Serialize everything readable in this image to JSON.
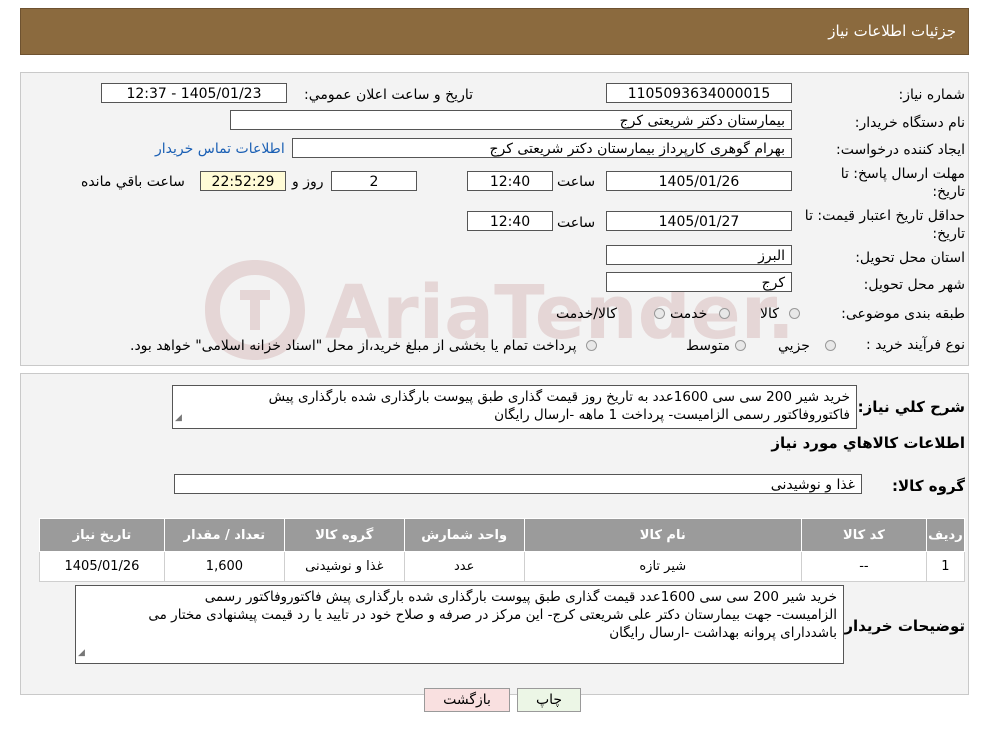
{
  "header": {
    "title": "جزئیات اطلاعات نیاز"
  },
  "fields": {
    "need_number_label": "شماره نیاز:",
    "need_number": "1105093634000015",
    "announce_label": "تاریخ و ساعت اعلان عمومي:",
    "announce_value": "1405/01/23 - 12:37",
    "buyer_org_label": "نام دستگاه خریدار:",
    "buyer_org": "بیمارستان دکتر شریعتی کرج",
    "creator_label": "ایجاد کننده درخواست:",
    "creator": "بهرام گوهری کارپرداز بیمارستان دکتر شریعتی کرج",
    "contact_link": "اطلاعات تماس خریدار",
    "reply_deadline_label_1": "مهلت ارسال پاسخ: تا",
    "reply_deadline_label_2": "تاریخ:",
    "reply_date": "1405/01/26",
    "time_label": "ساعت",
    "reply_time": "12:40",
    "days_value": "2",
    "days_label": "روز و",
    "remaining_time": "22:52:29",
    "remaining_label": "ساعت باقي مانده",
    "validity_label_1": "حداقل تاریخ اعتبار قیمت: تا",
    "validity_label_2": "تاریخ:",
    "validity_date": "1405/01/27",
    "validity_time_label": "ساعت",
    "validity_time": "12:40",
    "province_label": "استان محل تحویل:",
    "province": "البرز",
    "city_label": "شهر محل تحویل:",
    "city": "کرج",
    "category_label": "طبقه بندی موضوعی:",
    "category_options": [
      "کالا",
      "خدمت",
      "کالا/خدمت"
    ],
    "process_label": "نوع فرآیند خرید :",
    "process_options": [
      "جزیي",
      "متوسط"
    ],
    "process_note": "پرداخت تمام یا بخشی از مبلغ خرید،از محل \"اسناد خزانه اسلامی\" خواهد بود."
  },
  "description": {
    "label": "شرح کلي نیاز:",
    "line1": "خرید شیر 200 سی سی 1600عدد به تاریخ روز   قیمت گذاری طبق پیوست بارگذاری شده بارگذاری پیش",
    "line2": "فاکتوروفاکتور رسمی الزامیست-  پرداخت 1 ماهه  -ارسال رایگان"
  },
  "goods": {
    "section_title": "اطلاعات کالاهاي مورد نیاز",
    "group_label": "گروه کالا:",
    "group_value": "غذا و نوشیدنی",
    "columns": [
      "ردیف",
      "کد کالا",
      "نام کالا",
      "واحد شمارش",
      "گروه کالا",
      "تعداد / مقدار",
      "تاریخ نیاز"
    ],
    "rows": [
      [
        "1",
        "--",
        "شیر تازه",
        "عدد",
        "غذا و نوشیدنی",
        "1,600",
        "1405/01/26"
      ]
    ]
  },
  "buyer_notes": {
    "label": "توضیحات خریدار:",
    "line1": "خرید شیر 200 سی سی 1600عدد   قیمت گذاری       طبق پیوست بارگذاری شده بارگذاری پیش فاکتوروفاکتور رسمی",
    "line2": "الزامیست- جهت بیمارستان دکتر علی شریعتی کرج- این مرکز در صرفه و صلاح خود در تایید یا رد قیمت پیشنهادی مختار می",
    "line3": "باشددارای پروانه بهداشت -ارسال رایگان"
  },
  "buttons": {
    "print": "چاپ",
    "back": "بازگشت"
  },
  "watermark": {
    "text": "AriaTender.neT"
  }
}
